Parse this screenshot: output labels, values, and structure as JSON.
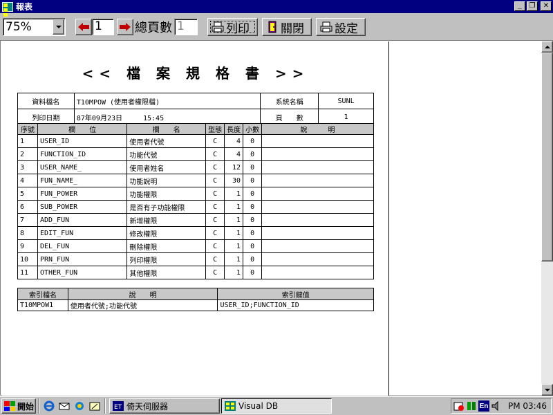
{
  "window": {
    "title": "報表"
  },
  "toolbar": {
    "zoom": "75%",
    "page": "1",
    "total_pages_label": "總頁數",
    "total_pages": "1",
    "print_label": "列印",
    "close_label": "關閉",
    "setup_label": "設定"
  },
  "document": {
    "title": "<< 檔 案 規 格 書 >>",
    "info": {
      "file_label": "資料檔名",
      "file_value": "T10MPOW (使用者權限檔)",
      "system_label": "系統名稱",
      "system_value": "SUNL",
      "date_label": "列印日期",
      "date_value": "87年09月23日",
      "time_value": "15:45",
      "page_label": "頁　　數",
      "page_value": "1"
    },
    "field_headers": [
      "序號",
      "欄　　位",
      "欄　　名",
      "型態",
      "長度",
      "小數",
      "說　　　明"
    ],
    "fields": [
      [
        "1",
        "USER_ID",
        "使用者代號",
        "C",
        "4",
        "0",
        ""
      ],
      [
        "2",
        "FUNCTION_ID",
        "功能代號",
        "C",
        "4",
        "0",
        ""
      ],
      [
        "3",
        "USER_NAME_",
        "使用者姓名",
        "C",
        "12",
        "0",
        ""
      ],
      [
        "4",
        "FUN_NAME_",
        "功能說明",
        "C",
        "30",
        "0",
        ""
      ],
      [
        "5",
        "FUN_POWER",
        "功能權限",
        "C",
        "1",
        "0",
        ""
      ],
      [
        "6",
        "SUB_POWER",
        "是否有子功能權限",
        "C",
        "1",
        "0",
        ""
      ],
      [
        "7",
        "ADD_FUN",
        "新增權限",
        "C",
        "1",
        "0",
        ""
      ],
      [
        "8",
        "EDIT_FUN",
        "修改權限",
        "C",
        "1",
        "0",
        ""
      ],
      [
        "9",
        "DEL_FUN",
        "刪除權限",
        "C",
        "1",
        "0",
        ""
      ],
      [
        "10",
        "PRN_FUN",
        "列印權限",
        "C",
        "1",
        "0",
        ""
      ],
      [
        "11",
        "OTHER_FUN",
        "其他權限",
        "C",
        "1",
        "0",
        ""
      ]
    ],
    "index_headers": [
      "索引檔名",
      "說　　明",
      "索引鍵值"
    ],
    "indexes": [
      [
        "T10MPOW1",
        "使用者代號;功能代號",
        "USER_ID;FUNCTION_ID"
      ]
    ]
  },
  "taskbar": {
    "start_label": "開始",
    "tasks": [
      "倚天伺服器",
      "Visual DB"
    ],
    "clock": "PM 03:46",
    "ime": "En"
  },
  "colors": {
    "title_bar": "#000080",
    "face": "#c0c0c0",
    "accent_red": "#c00000"
  }
}
